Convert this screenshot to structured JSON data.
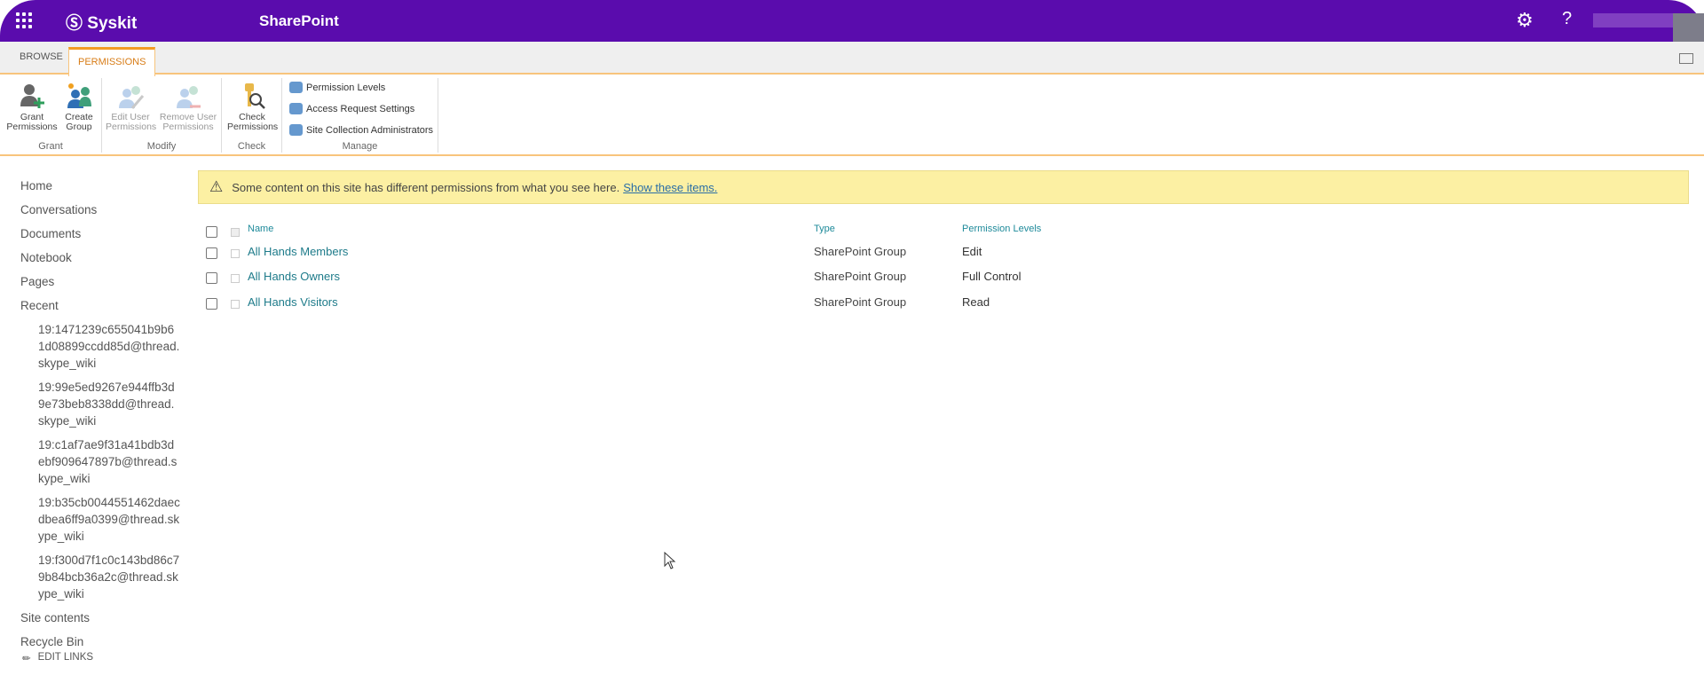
{
  "topbar": {
    "brand": "Syskit",
    "suite_title": "SharePoint",
    "brand_color": "#5a0cad"
  },
  "tabs": [
    {
      "label": "BROWSE"
    },
    {
      "label": "PERMISSIONS",
      "active": true
    }
  ],
  "ribbon": {
    "groups": [
      {
        "label": "Grant",
        "buttons": [
          {
            "label": "Grant Permissions",
            "icon": "grant-user-icon"
          },
          {
            "label": "Create Group",
            "icon": "create-group-icon"
          }
        ]
      },
      {
        "label": "Modify",
        "buttons": [
          {
            "label": "Edit User Permissions",
            "icon": "edit-user-icon",
            "disabled": true
          },
          {
            "label": "Remove User Permissions",
            "icon": "remove-user-icon",
            "disabled": true
          }
        ]
      },
      {
        "label": "Check",
        "buttons": [
          {
            "label": "Check Permissions",
            "icon": "key-search-icon"
          }
        ]
      },
      {
        "label": "Manage",
        "buttons": [
          {
            "label": "Permission Levels"
          },
          {
            "label": "Access Request Settings"
          },
          {
            "label": "Site Collection Administrators"
          }
        ]
      }
    ]
  },
  "nav": {
    "items": [
      "Home",
      "Conversations",
      "Documents",
      "Notebook",
      "Pages",
      "Recent"
    ],
    "recent": [
      "19:1471239c655041b9b61d08899ccdd85d@thread.skype_wiki",
      "19:99e5ed9267e944ffb3d9e73beb8338dd@thread.skype_wiki",
      "19:c1af7ae9f31a41bdb3debf909647897b@thread.skype_wiki",
      "19:b35cb0044551462daecdbea6ff9a0399@thread.skype_wiki",
      "19:f300d7f1c0c143bd86c79b84bcb36a2c@thread.skype_wiki"
    ],
    "bottom": [
      "Site contents",
      "Recycle Bin"
    ],
    "edit_links": "EDIT LINKS"
  },
  "banner": {
    "text": "Some content on this site has different permissions from what you see here.",
    "link": "Show these items."
  },
  "table": {
    "headers": {
      "name": "Name",
      "type": "Type",
      "perm": "Permission Levels"
    },
    "rows": [
      {
        "name": "All Hands Members",
        "type": "SharePoint Group",
        "perm": "Edit"
      },
      {
        "name": "All Hands Owners",
        "type": "SharePoint Group",
        "perm": "Full Control"
      },
      {
        "name": "All Hands Visitors",
        "type": "SharePoint Group",
        "perm": "Read"
      }
    ]
  }
}
